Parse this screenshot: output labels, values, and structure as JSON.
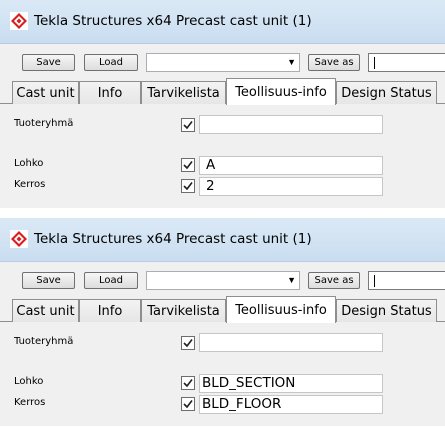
{
  "windows": [
    {
      "title": "Tekla Structures x64  Precast cast unit (1)",
      "toolbar": {
        "save_label": "Save",
        "load_label": "Load",
        "combo_value": "",
        "save_as_label": "Save as",
        "save_as_value": ""
      },
      "tabs": [
        "Cast unit",
        "Info",
        "Tarvikelista",
        "Teollisuus-info",
        "Design Status"
      ],
      "active_tab": "Teollisuus-info",
      "fields": [
        {
          "label": "Tuoteryhmä",
          "checked": true,
          "value": ""
        },
        {
          "label": "Lohko",
          "checked": true,
          "value": "A"
        },
        {
          "label": "Kerros",
          "checked": true,
          "value": "2"
        }
      ]
    },
    {
      "title": "Tekla Structures x64  Precast cast unit (1)",
      "toolbar": {
        "save_label": "Save",
        "load_label": "Load",
        "combo_value": "",
        "save_as_label": "Save as",
        "save_as_value": ""
      },
      "tabs": [
        "Cast unit",
        "Info",
        "Tarvikelista",
        "Teollisuus-info",
        "Design Status"
      ],
      "active_tab": "Teollisuus-info",
      "fields": [
        {
          "label": "Tuoteryhmä",
          "checked": true,
          "value": ""
        },
        {
          "label": "Lohko",
          "checked": true,
          "value": "BLD_SECTION"
        },
        {
          "label": "Kerros",
          "checked": true,
          "value": "BLD_FLOOR"
        }
      ]
    }
  ],
  "icons": {
    "app": "tekla-app-icon",
    "checkbox": "checkmark-icon",
    "combo": "chevron-down-icon"
  }
}
